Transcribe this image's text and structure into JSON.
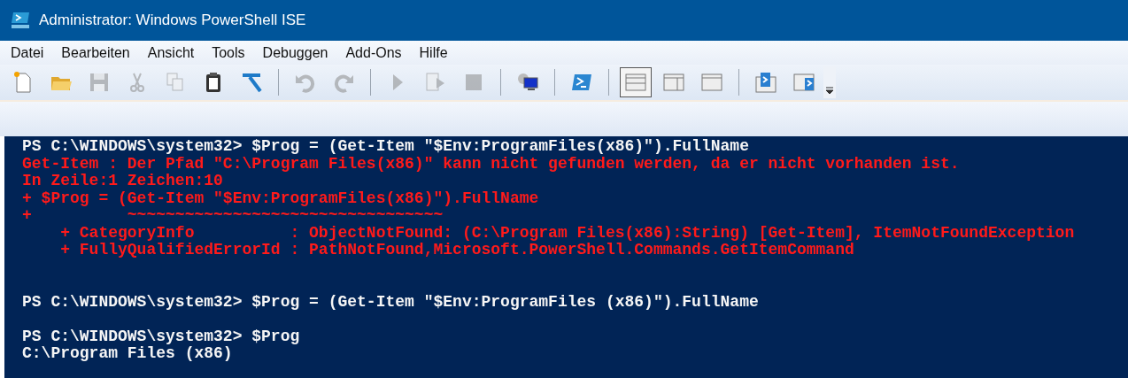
{
  "window": {
    "title": "Administrator: Windows PowerShell ISE"
  },
  "menu": [
    {
      "label": "Datei"
    },
    {
      "label": "Bearbeiten"
    },
    {
      "label": "Ansicht"
    },
    {
      "label": "Tools"
    },
    {
      "label": "Debuggen"
    },
    {
      "label": "Add-Ons"
    },
    {
      "label": "Hilfe"
    }
  ],
  "toolbar": [
    [
      {
        "kind": "new",
        "disabled": false
      },
      {
        "kind": "open",
        "disabled": false
      },
      {
        "kind": "save",
        "disabled": true
      },
      {
        "kind": "cut",
        "disabled": true
      },
      {
        "kind": "copy",
        "disabled": true
      },
      {
        "kind": "paste",
        "disabled": false
      },
      {
        "kind": "clear",
        "disabled": false
      }
    ],
    [
      {
        "kind": "undo",
        "disabled": true
      },
      {
        "kind": "redo",
        "disabled": true
      }
    ],
    [
      {
        "kind": "run",
        "disabled": true
      },
      {
        "kind": "runselection",
        "disabled": true
      },
      {
        "kind": "stop",
        "disabled": true
      }
    ],
    [
      {
        "kind": "remote",
        "disabled": false
      }
    ],
    [
      {
        "kind": "powershell",
        "disabled": false
      }
    ],
    [
      {
        "kind": "layouttop",
        "disabled": false,
        "selected": true
      },
      {
        "kind": "layoutright",
        "disabled": false,
        "selected": false
      },
      {
        "kind": "layoutmax",
        "disabled": false,
        "selected": false
      }
    ],
    [
      {
        "kind": "scriptpane",
        "disabled": false
      },
      {
        "kind": "scriptpaneright",
        "disabled": false
      }
    ]
  ],
  "console": {
    "blocks": [
      [
        {
          "kind": "command",
          "text": "PS C:\\WINDOWS\\system32> $Prog = (Get-Item \"$Env:ProgramFiles(x86)\").FullName"
        },
        {
          "kind": "error",
          "text": "Get-Item : Der Pfad \"C:\\Program Files(x86)\" kann nicht gefunden werden, da er nicht vorhanden ist."
        },
        {
          "kind": "error",
          "text": "In Zeile:1 Zeichen:10"
        },
        {
          "kind": "error",
          "text": "+ $Prog = (Get-Item \"$Env:ProgramFiles(x86)\").FullName"
        },
        {
          "kind": "error",
          "text": "+          ~~~~~~~~~~~~~~~~~~~~~~~~~~~~~~~~~"
        },
        {
          "kind": "error",
          "text": "    + CategoryInfo          : ObjectNotFound: (C:\\Program Files(x86):String) [Get-Item], ItemNotFoundException"
        },
        {
          "kind": "error",
          "text": "    + FullyQualifiedErrorId : PathNotFound,Microsoft.PowerShell.Commands.GetItemCommand"
        }
      ],
      [
        {
          "kind": "command",
          "text": "PS C:\\WINDOWS\\system32> $Prog = (Get-Item \"$Env:ProgramFiles (x86)\").FullName"
        }
      ],
      [
        {
          "kind": "command",
          "text": "PS C:\\WINDOWS\\system32> $Prog"
        },
        {
          "kind": "output",
          "text": "C:\\Program Files (x86)"
        }
      ]
    ]
  }
}
